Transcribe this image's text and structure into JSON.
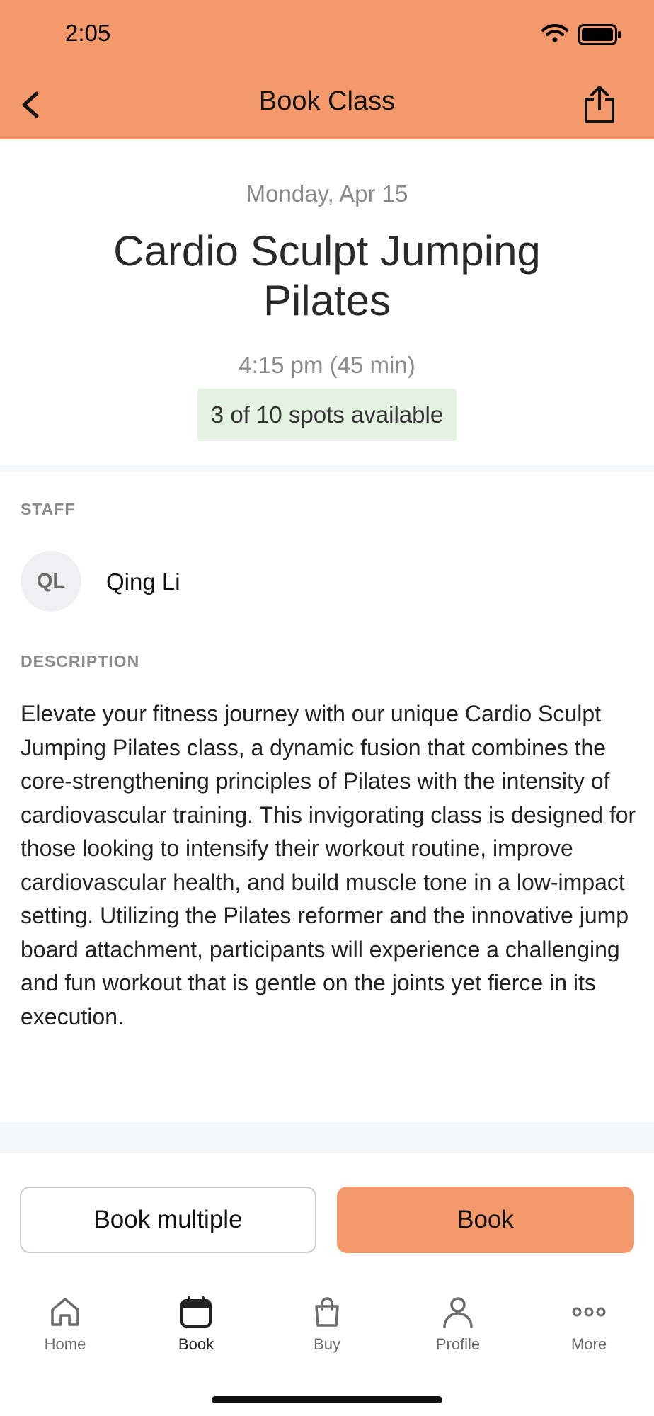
{
  "status_bar": {
    "time": "2:05"
  },
  "header": {
    "title": "Book Class"
  },
  "class": {
    "date": "Monday, Apr 15",
    "title": "Cardio Sculpt Jumping Pilates",
    "time": "4:15 pm (45 min)",
    "spots": "3 of 10 spots available"
  },
  "staff": {
    "label": "STAFF",
    "initials": "QL",
    "name": "Qing Li"
  },
  "description": {
    "label": "DESCRIPTION",
    "text": "Elevate your fitness journey with our unique Cardio Sculpt Jumping Pilates class, a dynamic fusion that combines the core-strengthening principles of Pilates with the intensity of cardiovascular training. This invigorating class is designed for those looking to intensify their workout routine, improve cardiovascular health, and build muscle tone in a low-impact setting. Utilizing the Pilates reformer and the innovative jump board attachment, participants will experience a challenging and fun workout that is gentle on the joints yet fierce in its execution."
  },
  "actions": {
    "book_multiple": "Book multiple",
    "book": "Book"
  },
  "tabbar": {
    "items": [
      {
        "label": "Home",
        "icon": "home-icon"
      },
      {
        "label": "Book",
        "icon": "calendar-icon"
      },
      {
        "label": "Buy",
        "icon": "shopping-bag-icon"
      },
      {
        "label": "Profile",
        "icon": "person-icon"
      },
      {
        "label": "More",
        "icon": "more-dots-icon"
      }
    ],
    "active": "Book"
  },
  "colors": {
    "accent": "#F4996C",
    "spots_bg": "#E4F3E1",
    "muted_text": "#8a8a8a"
  }
}
